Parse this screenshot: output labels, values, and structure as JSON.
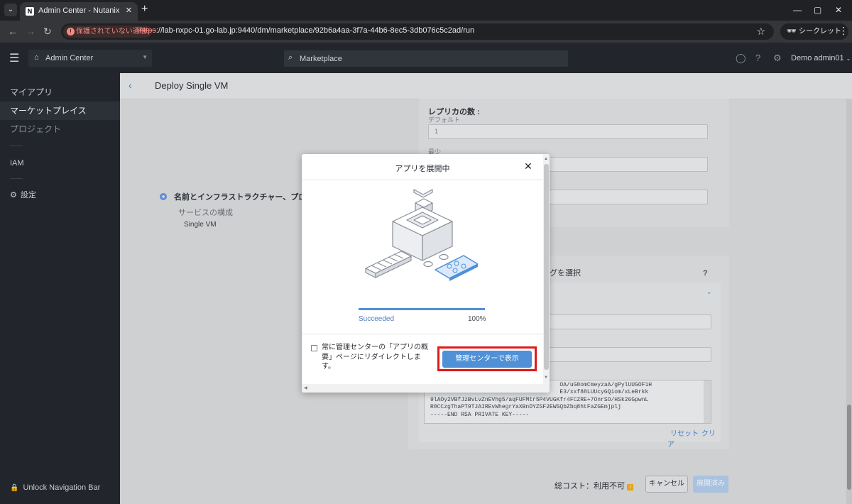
{
  "browser": {
    "tab_title": "Admin Center - Nutanix",
    "tab_favicon": "N",
    "security_label": "保護されていない通信",
    "url_scheme": "https",
    "url_rest": "://lab-nxpc-01.go-lab.jp:9440/dm/marketplace/92b6a4aa-3f7a-44b6-8ec5-3db076c5c2ad/run",
    "incognito_label": "シークレット"
  },
  "header": {
    "app_switcher": "Admin Center",
    "search_placeholder": "Marketplace",
    "user": "Demo admin01"
  },
  "sidebar": {
    "items": [
      {
        "label": "マイアプリ"
      },
      {
        "label": "マーケットプレイス"
      },
      {
        "label": "プロジェクト"
      },
      {
        "label": "IAM"
      },
      {
        "label": "設定"
      }
    ],
    "unlock": "Unlock Navigation Bar"
  },
  "page": {
    "title": "Deploy Single VM",
    "steps": [
      "名前とインフラストラクチャー、プロフ",
      "サービスの構成",
      "Single VM"
    ],
    "replica": {
      "title": "レプリカの数 :",
      "default_label": "デフォルト",
      "default_value": "1",
      "min_label": "最少"
    },
    "credential_title": "ングを選択",
    "help": "?",
    "key_lines": [
      "                                      OA/uG0omCmeyzaA/gPylUUGOF1H",
      "                                      E3/xxf88LUUcyGQiom/xLeBrkk",
      "9lAOy2VBfJzBvLvZnEVhg5/aqFUFMtr5P4VUGKfr4FCZRE+7OnrSO/HSk26GpwnL",
      "R0CCzgThaPT9TJAIREvWhegrYaXBnDYZSF2EWSQbZbq8htFaZGEmjplj",
      "-----END RSA PRIVATE KEY-----"
    ],
    "reset": "リセット",
    "clear": "クリア",
    "cost_label": "総コスト：利用不可",
    "cancel": "キャンセル",
    "deploy": "展開済み"
  },
  "modal": {
    "title": "アプリを展開中",
    "status": "Succeeded",
    "progress_percent": 100,
    "progress_label": "100%",
    "checkbox_label": "常に管理センターの「アプリの概要」ページにリダイレクトします。",
    "checkbox_checked": false,
    "cta": "管理センターで表示"
  },
  "colors": {
    "accent": "#4f90d6",
    "highlight_frame": "#e01a1a",
    "sidebar_bg": "#22252b"
  }
}
